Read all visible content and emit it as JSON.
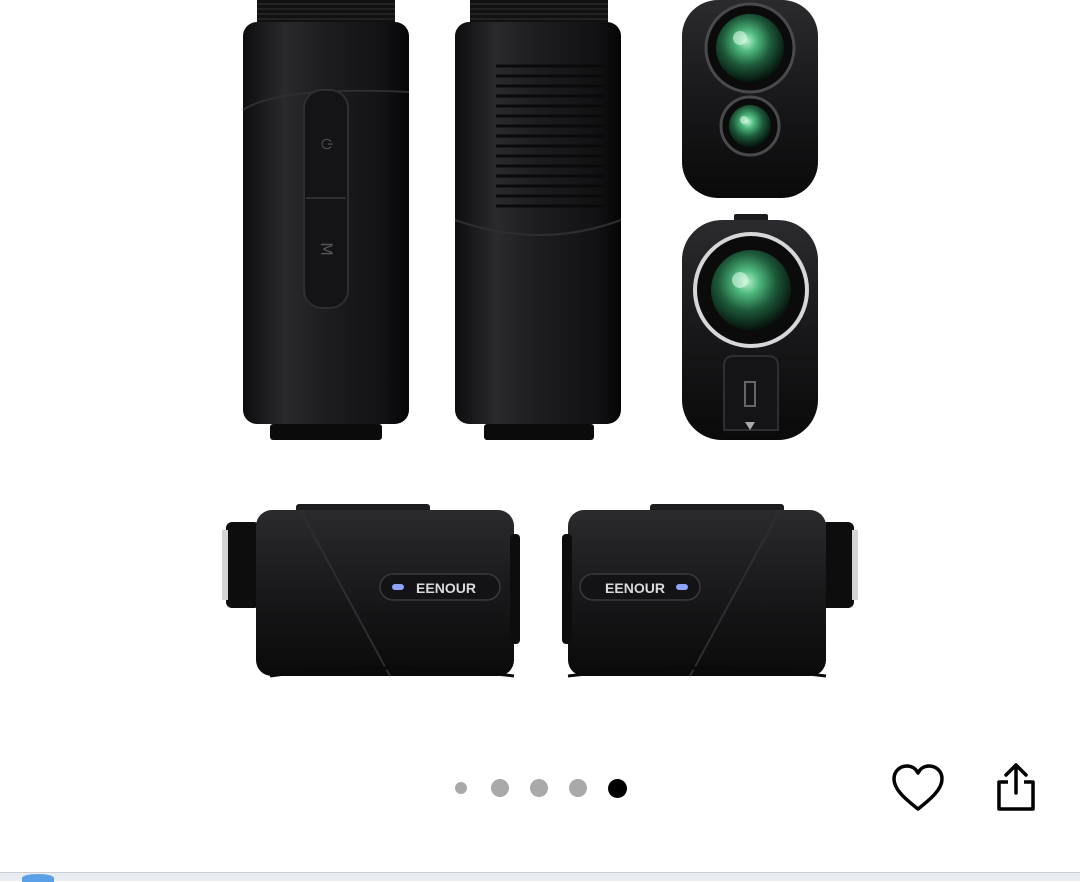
{
  "gallery": {
    "brand_label_left": "EENOUR",
    "brand_label_right": "EENOUR",
    "button_label_power": "⏻",
    "button_label_mode": "M",
    "image_count": 5,
    "active_index": 4
  },
  "actions": {
    "favorite_icon": "heart-icon",
    "share_icon": "share-icon"
  },
  "colors": {
    "active_dot": "#000000",
    "inactive_dot": "#a9a9a9",
    "device_body": "#1c1c1e",
    "lens_green": "#3fa06a"
  }
}
